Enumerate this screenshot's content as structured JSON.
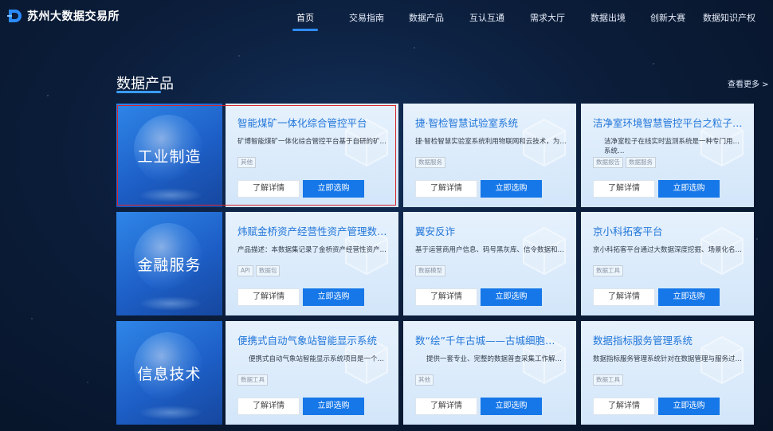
{
  "brand": {
    "name": "苏州大数据交易所"
  },
  "nav": {
    "items": [
      {
        "label": "首页",
        "active": true
      },
      {
        "label": "交易指南"
      },
      {
        "label": "数据产品"
      },
      {
        "label": "互认互通"
      },
      {
        "label": "需求大厅"
      },
      {
        "label": "数据出境"
      },
      {
        "label": "创新大赛"
      },
      {
        "label": "数据知识产权"
      }
    ]
  },
  "section": {
    "title": "数据产品",
    "more": "查看更多 >"
  },
  "categories": [
    {
      "label": "工业制造"
    },
    {
      "label": "金融服务"
    },
    {
      "label": "信息技术"
    }
  ],
  "cards": [
    {
      "title": "智能煤矿一体化综合管控平台",
      "desc": "矿博智能煤矿一体化综合管控平台基于自研的矿…",
      "tags": [
        "其他"
      ],
      "detail": "了解详情",
      "buy": "立即选购"
    },
    {
      "title": "捷·智检智慧试验室系统",
      "desc": "捷·智检智慧实验室系统利用物联网和云技术，为…",
      "tags": [
        "数据服务"
      ],
      "detail": "了解详情",
      "buy": "立即选购"
    },
    {
      "title": "洁净室环境智慧管控平台之粒子…",
      "desc": "洁净室粒子在线实时监测系统是一种专门用…系统…",
      "tags": [
        "数据报告",
        "数据服务"
      ],
      "detail": "了解详情",
      "buy": "立即选购"
    },
    {
      "title": "炜赋金桥资产经营性资产管理数…",
      "desc": "产品描述：本数据集记录了金桥资产经营性资产…",
      "tags": [
        "API",
        "数据包"
      ],
      "detail": "了解详情",
      "buy": "立即选购"
    },
    {
      "title": "翼安反诈",
      "desc": "基于运营商用户信息、码号黑灰库、信令数据和…",
      "tags": [
        "数据模型"
      ],
      "detail": "了解详情",
      "buy": "立即选购"
    },
    {
      "title": "京小科拓客平台",
      "desc": "京小科拓客平台通过大数据深度挖掘、场景化名…",
      "tags": [
        "数据工具"
      ],
      "detail": "了解详情",
      "buy": "立即选购"
    },
    {
      "title": "便携式自动气象站智能显示系统",
      "desc": "便携式自动气象站智能显示系统项目是一个…",
      "tags": [
        "数据工具"
      ],
      "detail": "了解详情",
      "buy": "立即选购"
    },
    {
      "title": "数“绘”千年古城——古城细胞…",
      "desc": "提供一套专业、完整的数据普查采集工作解…",
      "tags": [
        "其他"
      ],
      "detail": "了解详情",
      "buy": "立即选购"
    },
    {
      "title": "数据指标服务管理系统",
      "desc": "数据指标服务管理系统针对在数据管理与服务过…",
      "tags": [
        "数据工具"
      ],
      "detail": "了解详情",
      "buy": "立即选购"
    }
  ]
}
